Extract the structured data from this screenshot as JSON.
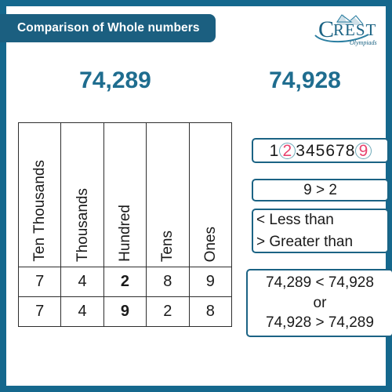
{
  "header": {
    "title": "Comparison of Whole numbers",
    "logo": {
      "name": "crest-olympiads-logo",
      "wordmark": "CREST",
      "tagline": "Olympiads"
    }
  },
  "numbers": {
    "left": "74,289",
    "right": "74,928"
  },
  "place_value_table": {
    "headers": [
      "Ten Thousands",
      "Thousands",
      "Hundred",
      "Tens",
      "Ones"
    ],
    "rows": [
      {
        "cells": [
          "7",
          "4",
          "2",
          "8",
          "9"
        ],
        "highlight_index": 2
      },
      {
        "cells": [
          "7",
          "4",
          "9",
          "2",
          "8"
        ],
        "highlight_index": 2
      }
    ]
  },
  "right_panel": {
    "digit_strip": {
      "digits": [
        "1",
        "2",
        "3",
        "4",
        "5",
        "6",
        "7",
        "8",
        "9"
      ],
      "circled": [
        1,
        8
      ]
    },
    "digit_comparison": "9 > 2",
    "legend": {
      "line1": "< Less than",
      "line2": "> Greater than"
    },
    "result": {
      "line1": "74,289 < 74,928",
      "line2": "or",
      "line3": "74,928 > 74,289"
    }
  },
  "colors": {
    "frame": "#15688d",
    "banner": "#1b5f80",
    "number_teal": "#1f6d8f",
    "highlight_pink": "#e8436f",
    "box_border": "#1b6384"
  }
}
